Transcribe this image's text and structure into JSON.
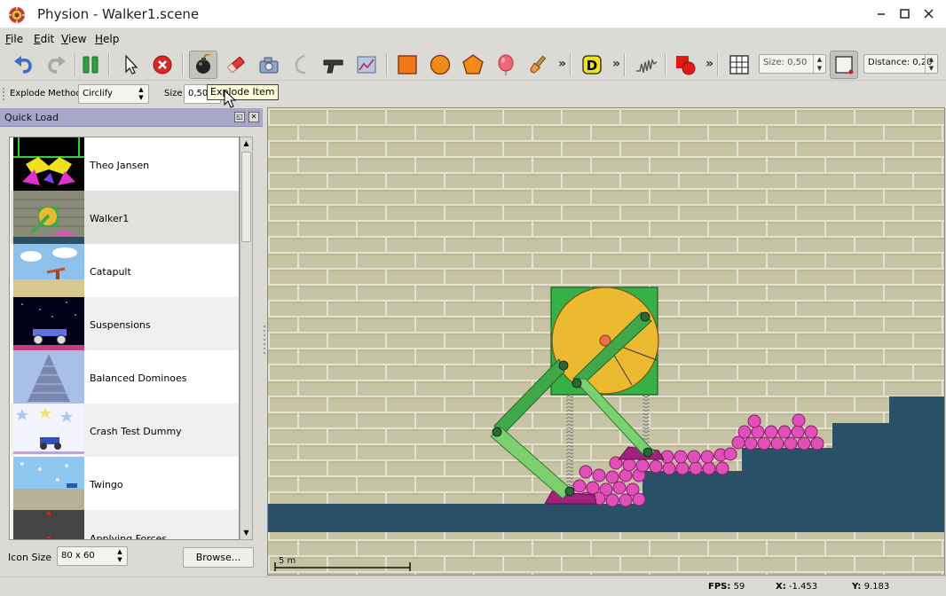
{
  "window": {
    "title": "Physion - Walker1.scene",
    "minimize_icon": "minimize-icon",
    "maximize_icon": "maximize-icon",
    "close_icon": "close-icon"
  },
  "menu": [
    {
      "label": "File",
      "mnemonic": "F",
      "rest": "ile"
    },
    {
      "label": "Edit",
      "mnemonic": "E",
      "rest": "dit"
    },
    {
      "label": "View",
      "mnemonic": "V",
      "rest": "iew"
    },
    {
      "label": "Help",
      "mnemonic": "H",
      "rest": "elp"
    }
  ],
  "toolbar": {
    "size_spin": "Size: 0,50",
    "distance_spin": "Distance: 0,20",
    "more_glyph": "»"
  },
  "options_bar": {
    "explode_method_label": "Explode Method",
    "explode_method_value": "Circlify",
    "size_label": "Size",
    "size_value": "0,50"
  },
  "tooltip": "Explode Item",
  "quick_load": {
    "title": "Quick Load",
    "items": [
      {
        "label": "Theo Jansen"
      },
      {
        "label": "Walker1"
      },
      {
        "label": "Catapult"
      },
      {
        "label": "Suspensions"
      },
      {
        "label": "Balanced Dominoes"
      },
      {
        "label": "Crash Test Dummy"
      },
      {
        "label": "Twingo"
      },
      {
        "label": "Applying Forces"
      }
    ],
    "selected_index": 1,
    "icon_size_label": "Icon Size",
    "icon_size_value": "80 x 60",
    "browse_label": "Browse..."
  },
  "canvas": {
    "scale_label": "5 m",
    "colors": {
      "brick": "#c7c4a5",
      "mortar": "#e4e2d2",
      "ground": "#2a5068",
      "ball": "#e050b8",
      "wheel": "#ecba30",
      "wheel_box": "#38b048",
      "leg_dark": "#40a848",
      "leg_light": "#7cd070",
      "base": "#a0227c"
    }
  },
  "status": {
    "fps_label": "FPS:",
    "fps_value": "59",
    "x_label": "X:",
    "x_value": "-1.453",
    "y_label": "Y:",
    "y_value": "9.183"
  }
}
